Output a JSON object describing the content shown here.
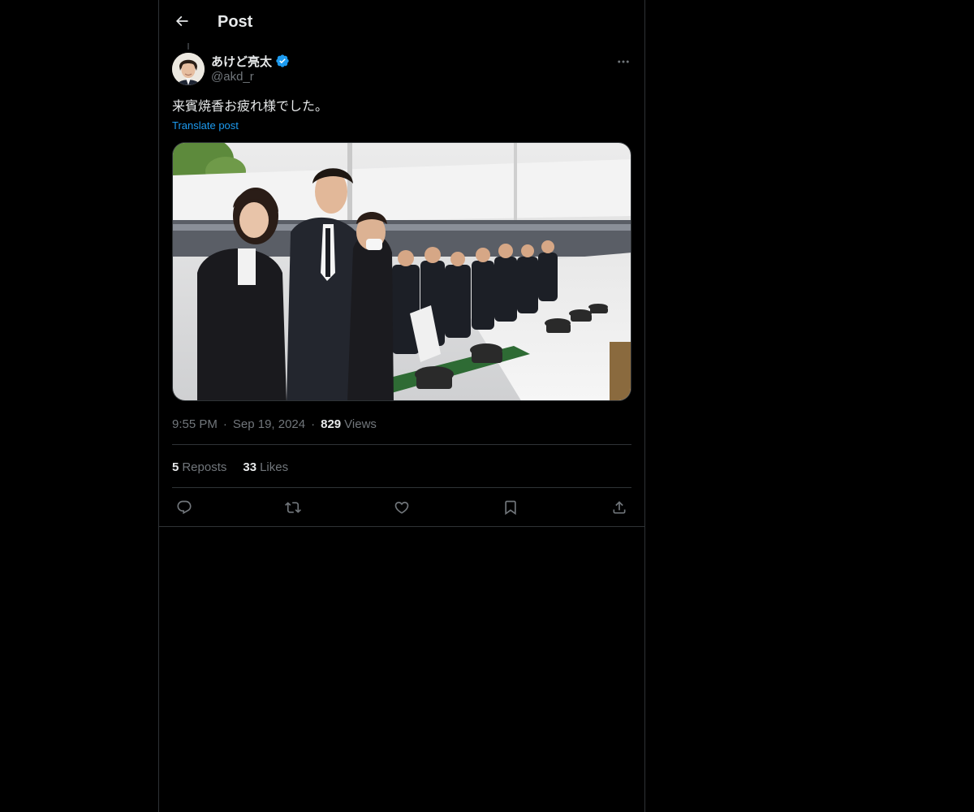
{
  "header": {
    "title": "Post",
    "back_icon": "arrow-left-icon"
  },
  "post": {
    "author": {
      "display_name": "あけど亮太",
      "handle": "@akd_r",
      "verified": true,
      "verified_color": "#1d9bf0"
    },
    "text": "来賓焼香お疲れ様でした。",
    "translate_label": "Translate post",
    "media": {
      "description_icon": "photo-image"
    },
    "time": "9:55 PM",
    "date": "Sep 19, 2024",
    "views_count": "829",
    "views_label": "Views",
    "separator": "·"
  },
  "stats": {
    "reposts_count": "5",
    "reposts_label": "Reposts",
    "likes_count": "33",
    "likes_label": "Likes"
  },
  "actions": {
    "reply_icon": "reply-icon",
    "repost_icon": "repost-icon",
    "like_icon": "heart-icon",
    "bookmark_icon": "bookmark-icon",
    "share_icon": "share-icon"
  },
  "colors": {
    "background": "#000000",
    "text_primary": "#e7e9ea",
    "text_secondary": "#71767b",
    "accent": "#1d9bf0",
    "border": "#2f3336"
  }
}
